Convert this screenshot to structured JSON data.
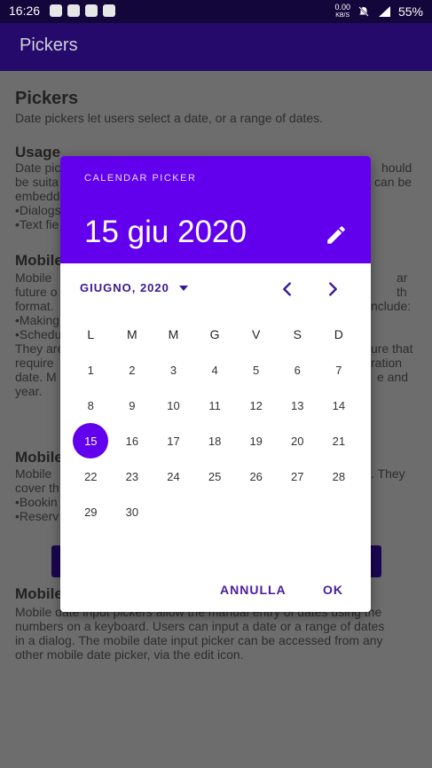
{
  "status_bar": {
    "time": "16:26",
    "net_speed": "0.00",
    "net_unit": "KB/S",
    "battery": "55%",
    "icons": [
      "telegram-icon",
      "whatsapp-icon",
      "outlook-icon",
      "outlook-icon",
      "mute-icon",
      "signal-4g-icon",
      "battery-icon"
    ]
  },
  "app_bar": {
    "title": "Pickers"
  },
  "page": {
    "title": "Pickers",
    "intro": "Date pickers let users select a date, or a range of dates.",
    "usage_heading": "Usage",
    "usage_lines": [
      "Date pic",
      "be suita",
      "embedd",
      "•Dialogs",
      "•Text fie"
    ],
    "usage_right": [
      "hould",
      "can be"
    ],
    "mobile_heading_1": "Mobile",
    "mobile_lines_1": [
      "Mobile",
      "future o",
      "format.",
      "•Making",
      "•Schedu",
      "They are",
      "require",
      "date. M",
      "year."
    ],
    "mobile_right_1": [
      "ar",
      "th",
      "nclude:",
      "ure that",
      "ration",
      "e and"
    ],
    "mobile_heading_2": "Mobile",
    "mobile_lines_2": [
      "Mobile",
      "cover th",
      "•Bookin",
      "•Reserv"
    ],
    "mobile_right_2": [
      ". They"
    ],
    "mobile_heading_3": "Mobile",
    "mobile_lines_3": [
      "Mobile date input pickers allow the manual entry of dates using the",
      "numbers on a keyboard. Users can input a date or a range of dates",
      "in a dialog. The mobile date input picker can be accessed from any",
      "other mobile date picker, via the edit icon."
    ]
  },
  "dialog": {
    "label": "CALENDAR PICKER",
    "selected_date": "15 giu 2020",
    "month_label": "GIUGNO, 2020",
    "weekdays": [
      "L",
      "M",
      "M",
      "G",
      "V",
      "S",
      "D"
    ],
    "weeks": [
      [
        "1",
        "2",
        "3",
        "4",
        "5",
        "6",
        "7"
      ],
      [
        "8",
        "9",
        "10",
        "11",
        "12",
        "13",
        "14"
      ],
      [
        "15",
        "16",
        "17",
        "18",
        "19",
        "20",
        "21"
      ],
      [
        "22",
        "23",
        "24",
        "25",
        "26",
        "27",
        "28"
      ],
      [
        "29",
        "30",
        "",
        "",
        "",
        "",
        ""
      ]
    ],
    "selected_day": "15",
    "cancel_label": "ANNULLA",
    "ok_label": "OK"
  },
  "colors": {
    "accent": "#6200ee",
    "app_bar": "#250a6b",
    "status_bar": "#12063a",
    "scrim": "#6d6d6d"
  }
}
